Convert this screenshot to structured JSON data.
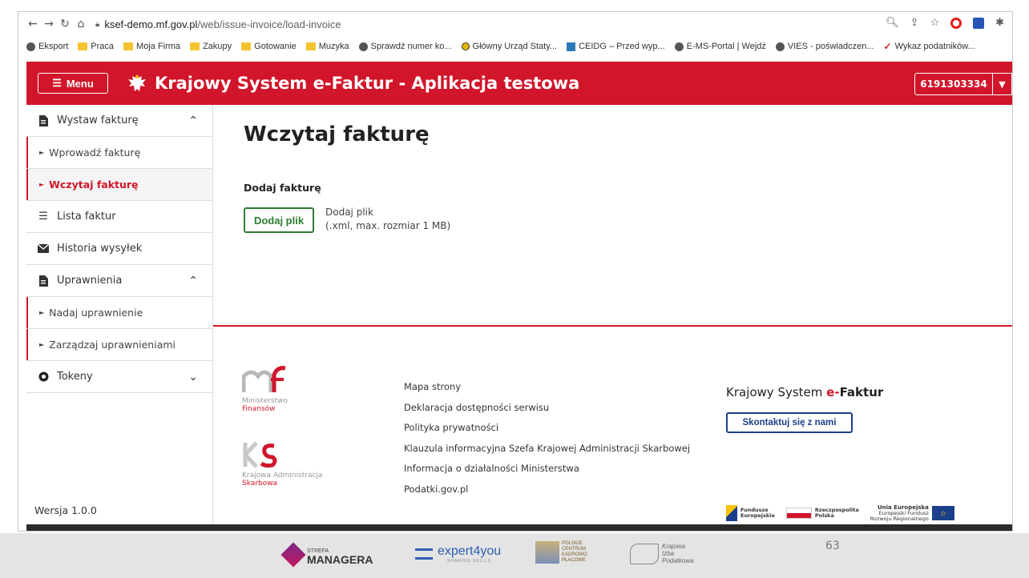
{
  "browser": {
    "url_host": "ksef-demo.mf.gov.pl",
    "url_path": "/web/issue-invoice/load-invoice",
    "bookmarks": [
      {
        "label": "Eksport",
        "icon": "globe"
      },
      {
        "label": "Praca",
        "icon": "folder"
      },
      {
        "label": "Moja Firma",
        "icon": "folder"
      },
      {
        "label": "Zakupy",
        "icon": "folder"
      },
      {
        "label": "Gotowanie",
        "icon": "folder"
      },
      {
        "label": "Muzyka",
        "icon": "folder"
      },
      {
        "label": "Sprawdź numer ko...",
        "icon": "globe"
      },
      {
        "label": "Główny Urząd Staty...",
        "icon": "yellowdot"
      },
      {
        "label": "CEIDG – Przed wyp...",
        "icon": "bluesq"
      },
      {
        "label": "E-MS-Portal | Wejdź",
        "icon": "globe"
      },
      {
        "label": "VIES - poświadczen...",
        "icon": "globe"
      },
      {
        "label": "Wykaz podatników...",
        "icon": "redmark"
      }
    ]
  },
  "header": {
    "menu_label": "Menu",
    "title": "Krajowy System e-Faktur - Aplikacja testowa",
    "nip": "6191303334"
  },
  "sidebar": {
    "items": [
      {
        "label": "Wystaw fakturę",
        "type": "group",
        "icon": "document-icon",
        "expanded": true
      },
      {
        "label": "Wprowadź fakturę",
        "type": "sub"
      },
      {
        "label": "Wczytaj fakturę",
        "type": "sub",
        "active": true
      },
      {
        "label": "Lista faktur",
        "type": "item",
        "icon": "list-icon"
      },
      {
        "label": "Historia wysyłek",
        "type": "item",
        "icon": "envelope-icon"
      },
      {
        "label": "Uprawnienia",
        "type": "group",
        "icon": "document-icon",
        "expanded": true
      },
      {
        "label": "Nadaj uprawnienie",
        "type": "sub"
      },
      {
        "label": "Zarządzaj uprawnieniami",
        "type": "sub"
      },
      {
        "label": "Tokeny",
        "type": "group",
        "icon": "token-icon",
        "expanded": false
      }
    ],
    "version": "Wersja 1.0.0"
  },
  "main": {
    "title": "Wczytaj fakturę",
    "section_label": "Dodaj fakturę",
    "add_button": "Dodaj plik",
    "hint_line1": "Dodaj plik",
    "hint_line2": "(.xml, max. rozmiar 1 MB)"
  },
  "footer": {
    "mf_caption_1": "Ministerstwo",
    "mf_caption_2": "Finansów",
    "kas_caption_1": "Krajowa Administracja",
    "kas_caption_2": "Skarbowa",
    "links": [
      "Mapa strony",
      "Deklaracja dostępności serwisu",
      "Polityka prywatności",
      "Klauzula informacyjna Szefa Krajowej Administracji Skarbowej",
      "Informacja o działalności Ministerstwa",
      "Podatki.gov.pl"
    ],
    "brand_1": "Krajowy System ",
    "brand_e": "e-",
    "brand_2": "Faktur",
    "contact_button": "Skontaktuj się z nami",
    "eu_fe_1": "Fundusze",
    "eu_fe_2": "Europejskie",
    "eu_rp_1": "Rzeczpospolita",
    "eu_rp_2": "Polska",
    "eu_ue_1": "Unia Europejska",
    "eu_ue_2": "Europejski Fundusz",
    "eu_ue_3": "Rozwoju Regionalnego"
  },
  "slide": {
    "strefa_1": "STREFA",
    "strefa_2": "MANAGERA",
    "expert": "expert4you",
    "expert_sub": "SHARING SKILLS",
    "pckp_1": "POLSKIE",
    "pckp_2": "CENTRUM",
    "pckp_3": "KADROWO",
    "pckp_4": "PŁACOWE",
    "kip_1": "Krajowa",
    "kip_2": "Izba",
    "kip_3": "Podatkowa",
    "page_number": "63"
  },
  "colors": {
    "brand_red": "#d1152a",
    "success_green": "#2e7d32",
    "navy": "#1b3f8b"
  }
}
